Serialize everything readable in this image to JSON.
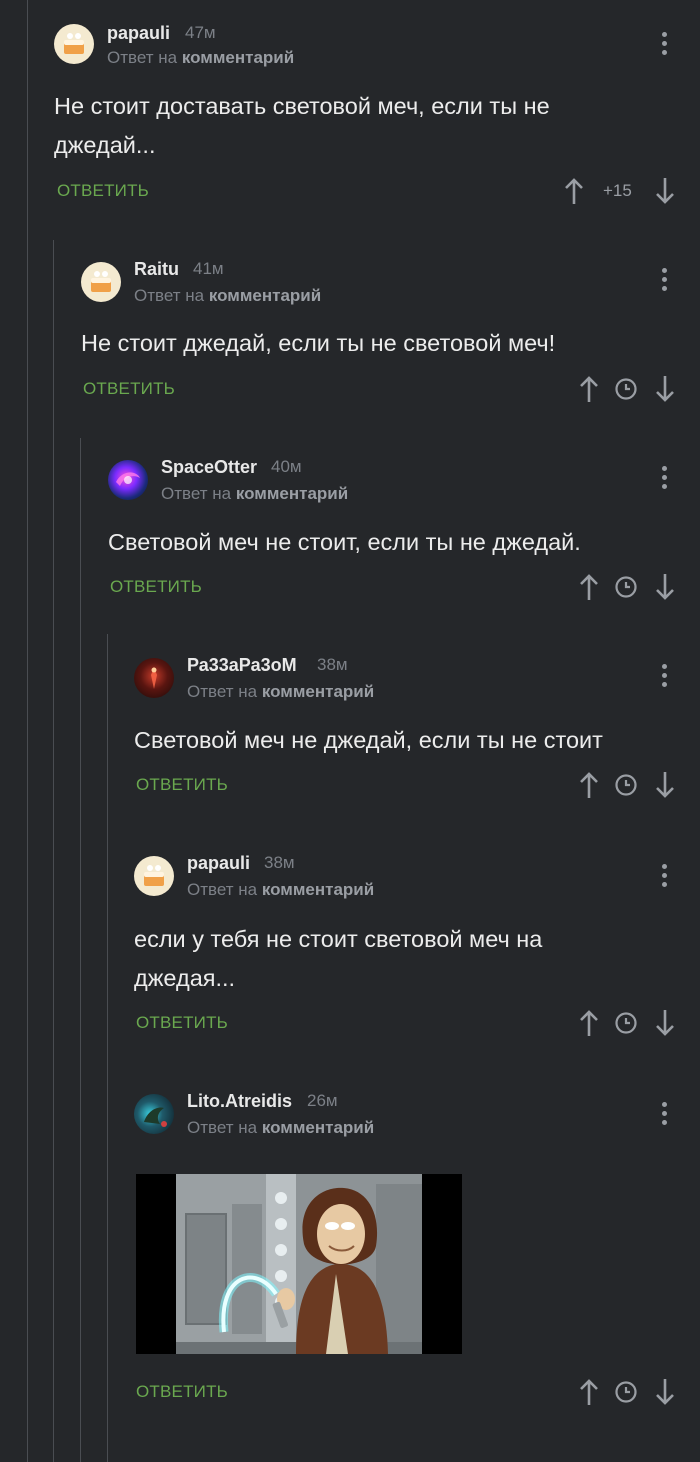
{
  "comments": [
    {
      "user": "papauli",
      "time": "47м",
      "reply_prefix": "Ответ на",
      "reply_target": "комментарий",
      "text": "Не стоит доставать световой меч, если ты не джедай...",
      "reply": "ОТВЕТИТЬ",
      "score": "+15",
      "avatar": "cake-icon"
    },
    {
      "user": "Raitu",
      "time": "41м",
      "reply_prefix": "Ответ на",
      "reply_target": "комментарий",
      "text": "Не стоит джедай, если ты не световой меч!",
      "reply": "ОТВЕТИТЬ",
      "avatar": "cake-icon"
    },
    {
      "user": "SpaceOtter",
      "time": "40м",
      "reply_prefix": "Ответ на",
      "reply_target": "комментарий",
      "text": "Световой меч не стоит, если ты не джедай.",
      "reply": "ОТВЕТИТЬ",
      "avatar": "galaxy-icon"
    },
    {
      "user": "Ра33аРа3оМ",
      "time": "38м",
      "reply_prefix": "Ответ на",
      "reply_target": "комментарий",
      "text": "Световой меч не джедай, если ты не стоит",
      "reply": "ОТВЕТИТЬ",
      "avatar": "red-figure-icon"
    },
    {
      "user": "papauli",
      "time": "38м",
      "reply_prefix": "Ответ на",
      "reply_target": "комментарий",
      "text": "если у тебя не стоит световой меч на джедая...",
      "reply": "ОТВЕТИТЬ",
      "avatar": "cake-icon"
    },
    {
      "user": "Lito.Atreidis",
      "time": "26м",
      "reply_prefix": "Ответ на",
      "reply_target": "комментарий",
      "reply": "ОТВЕТИТЬ",
      "avatar": "dragon-icon",
      "image": "cartoon-jedi-with-bent-lightsaber-image"
    }
  ],
  "icons": {
    "up": "arrow-up-icon",
    "down": "arrow-down-icon",
    "clock": "clock-icon",
    "menu": "more-vertical-icon"
  },
  "colors": {
    "background": "#25272a",
    "reply_green": "#6aa84f",
    "muted": "#7c8087"
  }
}
